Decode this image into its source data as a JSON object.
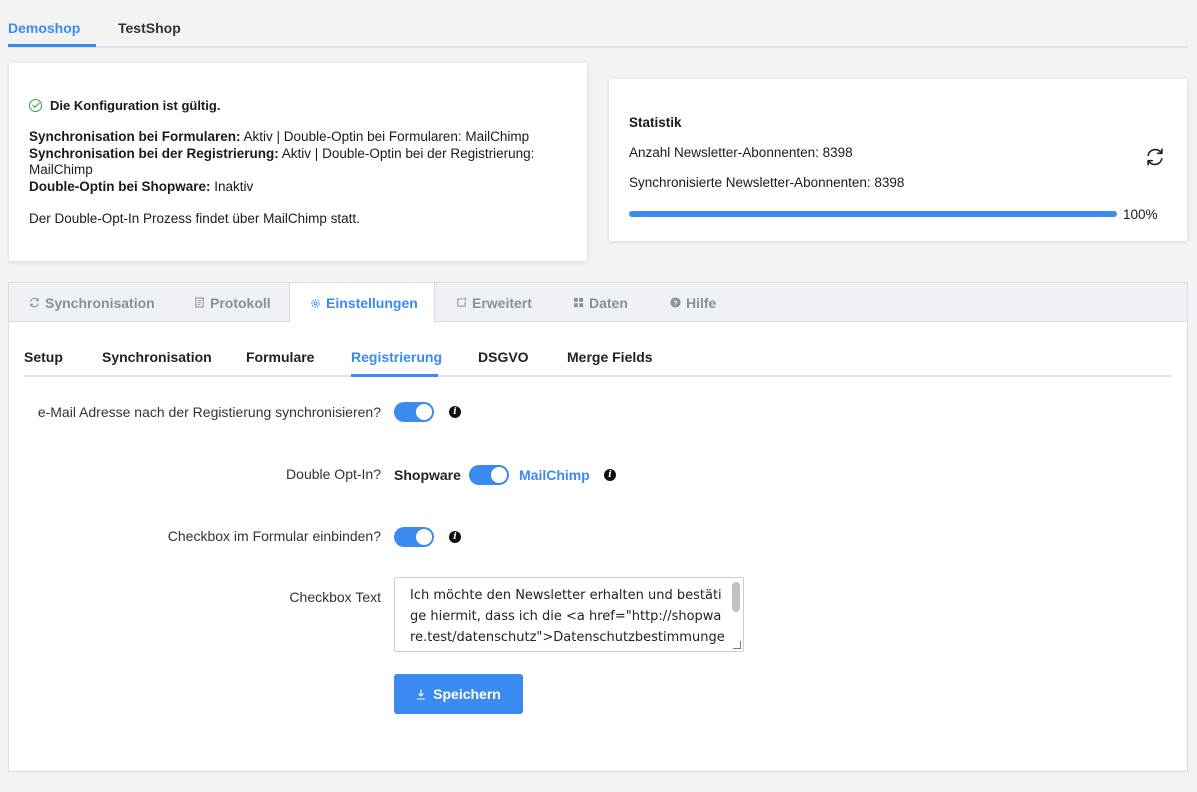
{
  "shop_tabs": [
    {
      "label": "Demoshop",
      "active": true
    },
    {
      "label": "TestShop",
      "active": false
    }
  ],
  "config": {
    "valid_message": "Die Konfiguration ist gültig.",
    "lines": [
      {
        "key": "Synchronisation bei Formularen:",
        "value": " Aktiv | Double-Optin bei Formularen: MailChimp"
      },
      {
        "key": "Synchronisation bei der Registrierung:",
        "value": " Aktiv | Double-Optin bei der Registrierung: MailChimp"
      },
      {
        "key": "Double-Optin bei Shopware:",
        "value": " Inaktiv"
      }
    ],
    "note": "Der Double-Opt-In Prozess findet über MailChimp statt."
  },
  "stats": {
    "title": "Statistik",
    "subscribers": "Anzahl Newsletter-Abonnenten: 8398",
    "synced": "Synchronisierte Newsletter-Abonnenten: 8398",
    "progress_percent": 100,
    "progress_label": "100%"
  },
  "main_tabs": [
    {
      "label": "Synchronisation",
      "icon": "sync-icon",
      "active": false
    },
    {
      "label": "Protokoll",
      "icon": "document-icon",
      "active": false
    },
    {
      "label": "Einstellungen",
      "icon": "gear-icon",
      "active": true
    },
    {
      "label": "Erweitert",
      "icon": "external-icon",
      "active": false
    },
    {
      "label": "Daten",
      "icon": "grid-icon",
      "active": false
    },
    {
      "label": "Hilfe",
      "icon": "help-icon",
      "active": false
    }
  ],
  "sub_tabs": [
    {
      "label": "Setup",
      "active": false
    },
    {
      "label": "Synchronisation",
      "active": false
    },
    {
      "label": "Formulare",
      "active": false
    },
    {
      "label": "Registrierung",
      "active": true
    },
    {
      "label": "DSGVO",
      "active": false
    },
    {
      "label": "Merge Fields",
      "active": false
    }
  ],
  "settings": {
    "sync_after_registration": {
      "label": "e-Mail Adresse nach der Registierung synchronisieren?",
      "enabled": true
    },
    "double_opt_in": {
      "label": "Double Opt-In?",
      "left": "Shopware",
      "right": "MailChimp",
      "selected": "MailChimp"
    },
    "checkbox_in_form": {
      "label": "Checkbox im Formular einbinden?",
      "enabled": true
    },
    "checkbox_text": {
      "label": "Checkbox Text",
      "value": "Ich möchte den Newsletter erhalten und bestätige hiermit, dass ich die <a href=\"http://shopware.test/datenschutz\">Datenschutzbestimmungen</a> gelesen habe."
    },
    "save_label": "Speichern"
  },
  "colors": {
    "accent": "#3b8af0",
    "valid": "#2fa34a"
  }
}
